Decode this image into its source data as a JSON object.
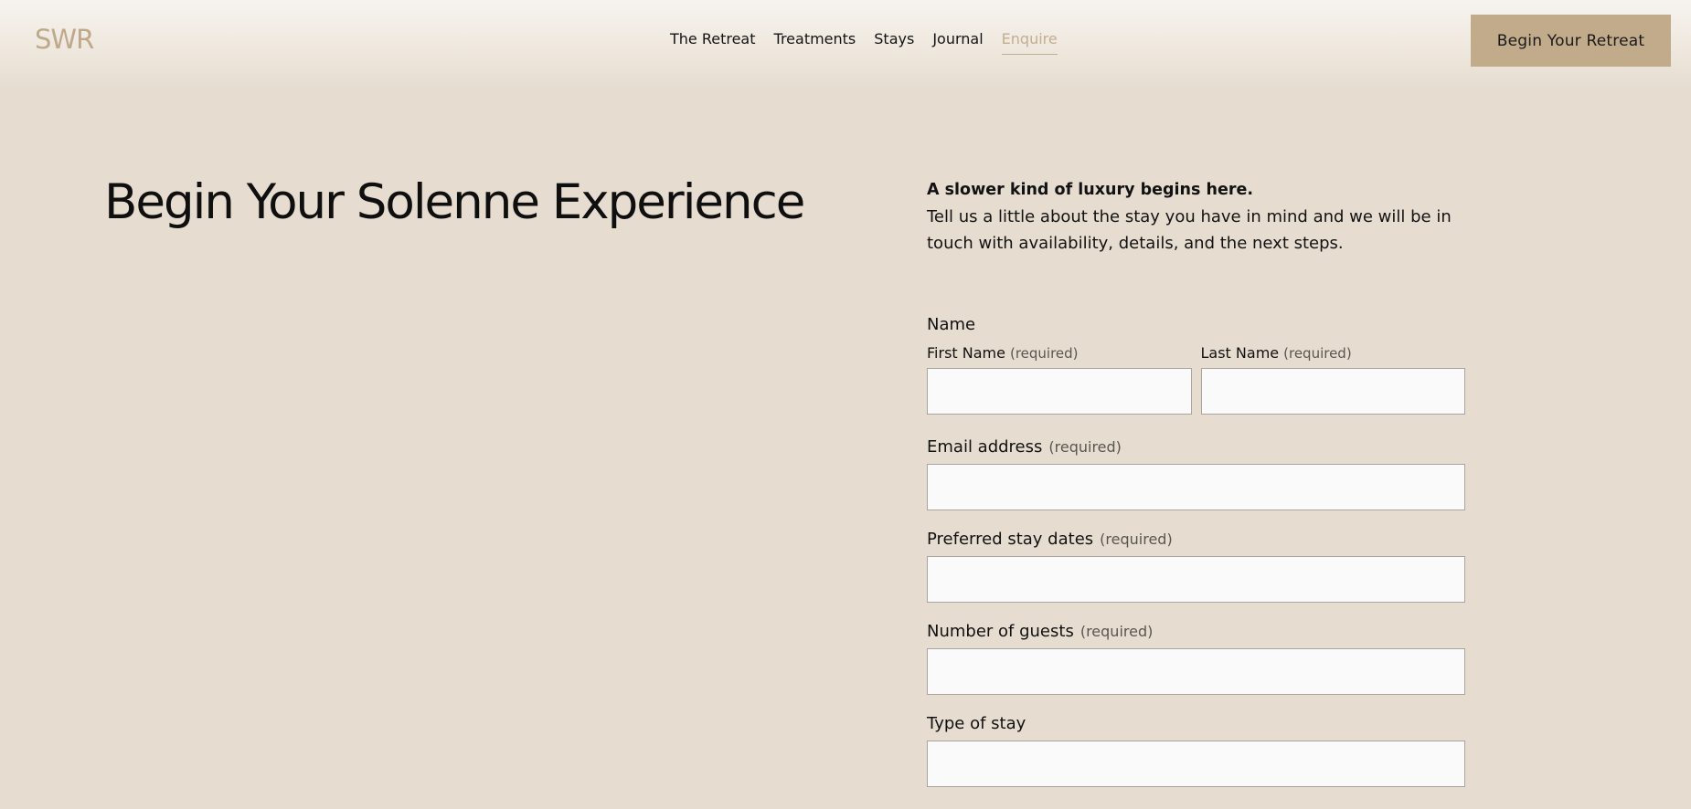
{
  "header": {
    "logo": "SWR",
    "nav": [
      {
        "label": "The Retreat"
      },
      {
        "label": "Treatments"
      },
      {
        "label": "Stays"
      },
      {
        "label": "Journal"
      },
      {
        "label": "Enquire",
        "active": true
      }
    ],
    "cta_label": "Begin Your Retreat"
  },
  "hero": {
    "title": "Begin Your Solenne Experience"
  },
  "intro": {
    "lead": "A slower kind of luxury begins here.",
    "body": "Tell us a little about the stay you have in mind and we will be in touch with availability, details, and the next steps."
  },
  "form": {
    "name_group_label": "Name",
    "first_name_label": "First Name",
    "last_name_label": "Last Name",
    "required_text": "(required)",
    "email_label": "Email address",
    "dates_label": "Preferred stay dates",
    "guests_label": "Number of guests",
    "stay_type_label": "Type of stay",
    "first_name_value": "",
    "last_name_value": "",
    "email_value": "",
    "dates_value": "",
    "guests_value": "",
    "stay_type_value": ""
  },
  "colors": {
    "background": "#e6ddd0",
    "accent": "#c2ab8b",
    "nav_active": "#c3ae90",
    "input_bg": "#fafafa"
  }
}
